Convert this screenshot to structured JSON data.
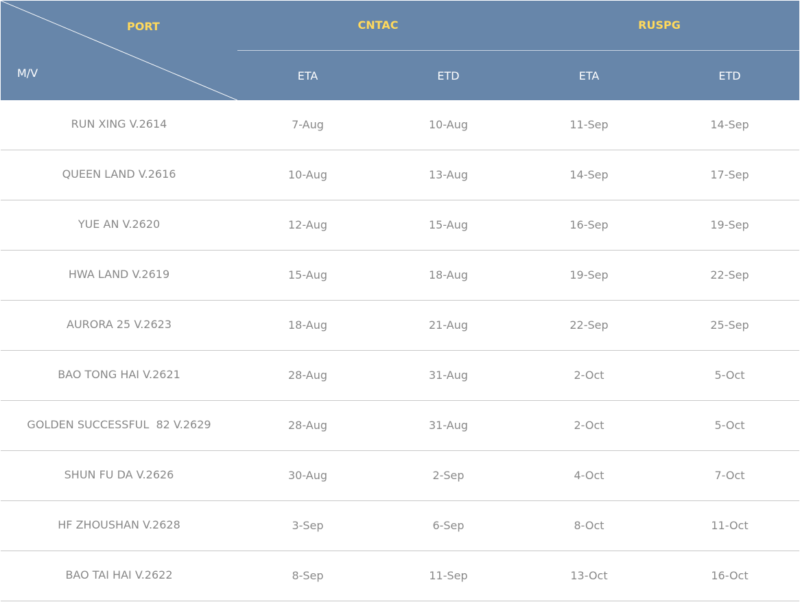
{
  "header": {
    "port_label": "PORT",
    "vessel_label": "M/V",
    "ports": [
      {
        "name": "CNTAC",
        "columns": [
          "ETA",
          "ETD"
        ]
      },
      {
        "name": "RUSPG",
        "columns": [
          "ETA",
          "ETD"
        ]
      }
    ]
  },
  "rows": [
    {
      "vessel": "RUN XING V.2614",
      "cntac_eta": "7-Aug",
      "cntac_etd": "10-Aug",
      "ruspg_eta": "11-Sep",
      "ruspg_etd": "14-Sep"
    },
    {
      "vessel": "QUEEN LAND V.2616",
      "cntac_eta": "10-Aug",
      "cntac_etd": "13-Aug",
      "ruspg_eta": "14-Sep",
      "ruspg_etd": "17-Sep"
    },
    {
      "vessel": "YUE AN V.2620",
      "cntac_eta": "12-Aug",
      "cntac_etd": "15-Aug",
      "ruspg_eta": "16-Sep",
      "ruspg_etd": "19-Sep"
    },
    {
      "vessel": "HWA LAND V.2619",
      "cntac_eta": "15-Aug",
      "cntac_etd": "18-Aug",
      "ruspg_eta": "19-Sep",
      "ruspg_etd": "22-Sep"
    },
    {
      "vessel": "AURORA 25 V.2623",
      "cntac_eta": "18-Aug",
      "cntac_etd": "21-Aug",
      "ruspg_eta": "22-Sep",
      "ruspg_etd": "25-Sep"
    },
    {
      "vessel": "BAO TONG HAI V.2621",
      "cntac_eta": "28-Aug",
      "cntac_etd": "31-Aug",
      "ruspg_eta": "2-Oct",
      "ruspg_etd": "5-Oct"
    },
    {
      "vessel": "GOLDEN SUCCESSFUL  82 V.2629",
      "cntac_eta": "28-Aug",
      "cntac_etd": "31-Aug",
      "ruspg_eta": "2-Oct",
      "ruspg_etd": "5-Oct"
    },
    {
      "vessel": "SHUN FU DA V.2626",
      "cntac_eta": "30-Aug",
      "cntac_etd": "2-Sep",
      "ruspg_eta": "4-Oct",
      "ruspg_etd": "7-Oct"
    },
    {
      "vessel": "HF ZHOUSHAN V.2628",
      "cntac_eta": "3-Sep",
      "cntac_etd": "6-Sep",
      "ruspg_eta": "8-Oct",
      "ruspg_etd": "11-Oct"
    },
    {
      "vessel": "BAO TAI HAI V.2622",
      "cntac_eta": "8-Sep",
      "cntac_etd": "11-Sep",
      "ruspg_eta": "13-Oct",
      "ruspg_etd": "16-Oct"
    }
  ],
  "colors": {
    "header_bg": "#6786aa",
    "port_name": "#ffd95c",
    "header_text": "#ffffff",
    "body_text": "#888888",
    "row_divider": "#c8c8c8"
  }
}
